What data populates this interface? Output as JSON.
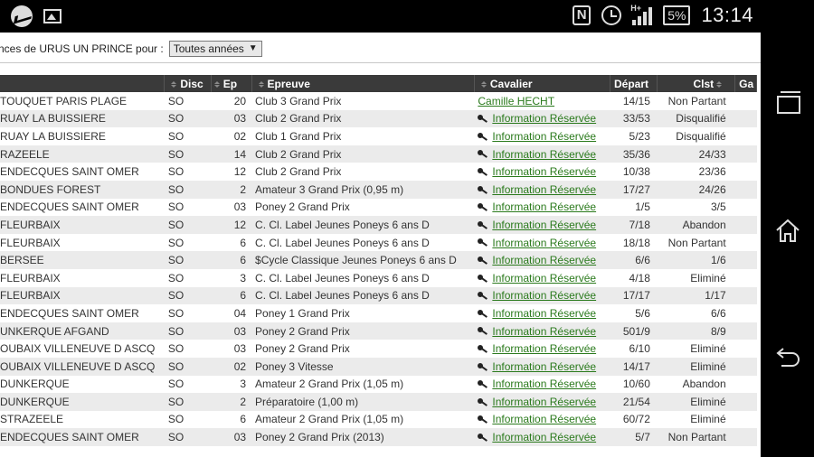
{
  "statusbar": {
    "nfc": "N",
    "network": "H+",
    "battery": "5%",
    "time": "13:14"
  },
  "filter": {
    "label": "nces de URUS UN PRINCE pour :",
    "selected": "Toutes années",
    "caret": "▼"
  },
  "table": {
    "headers": {
      "lieu": "",
      "disc": "Disc",
      "ep": "Ep",
      "epreuve": "Epreuve",
      "cavalier": "Cavalier",
      "depart": "Départ",
      "clst": "Clst",
      "gain": "Ga"
    },
    "rows": [
      {
        "lieu": " TOUQUET PARIS PLAGE",
        "disc": "SO",
        "ep": "20",
        "epreuve": "Club 3 Grand Prix",
        "cavalier": "Camille HECHT",
        "reserved": false,
        "depart": "14/15",
        "clst": "Non Partant"
      },
      {
        "lieu": "RUAY LA BUISSIERE",
        "disc": "SO",
        "ep": "03",
        "epreuve": "Club 2 Grand Prix",
        "cavalier": "Information Réservée",
        "reserved": true,
        "depart": "33/53",
        "clst": "Disqualifié"
      },
      {
        "lieu": "RUAY LA BUISSIERE",
        "disc": "SO",
        "ep": "02",
        "epreuve": "Club 1 Grand Prix",
        "cavalier": "Information Réservée",
        "reserved": true,
        "depart": "5/23",
        "clst": "Disqualifié"
      },
      {
        "lieu": "RAZEELE",
        "disc": "SO",
        "ep": "14",
        "epreuve": "Club 2 Grand Prix",
        "cavalier": "Information Réservée",
        "reserved": true,
        "depart": "35/36",
        "clst": "24/33"
      },
      {
        "lieu": "ENDECQUES SAINT OMER",
        "disc": "SO",
        "ep": "12",
        "epreuve": "Club 2 Grand Prix",
        "cavalier": "Information Réservée",
        "reserved": true,
        "depart": "10/38",
        "clst": "23/36"
      },
      {
        "lieu": "BONDUES FOREST",
        "disc": "SO",
        "ep": "2",
        "epreuve": "Amateur 3 Grand Prix (0,95 m)",
        "cavalier": "Information Réservée",
        "reserved": true,
        "depart": "17/27",
        "clst": "24/26"
      },
      {
        "lieu": "ENDECQUES SAINT OMER",
        "disc": "SO",
        "ep": "03",
        "epreuve": "Poney 2 Grand Prix",
        "cavalier": "Information Réservée",
        "reserved": true,
        "depart": "1/5",
        "clst": "3/5"
      },
      {
        "lieu": "FLEURBAIX",
        "disc": "SO",
        "ep": "12",
        "epreuve": "C. Cl. Label Jeunes Poneys 6 ans D",
        "cavalier": "Information Réservée",
        "reserved": true,
        "depart": "7/18",
        "clst": "Abandon"
      },
      {
        "lieu": "FLEURBAIX",
        "disc": "SO",
        "ep": "6",
        "epreuve": "C. Cl. Label Jeunes Poneys 6 ans D",
        "cavalier": "Information Réservée",
        "reserved": true,
        "depart": "18/18",
        "clst": "Non Partant"
      },
      {
        "lieu": "BERSEE",
        "disc": "SO",
        "ep": "6",
        "epreuve": "$Cycle Classique Jeunes Poneys 6 ans D",
        "cavalier": "Information Réservée",
        "reserved": true,
        "depart": "6/6",
        "clst": "1/6"
      },
      {
        "lieu": "FLEURBAIX",
        "disc": "SO",
        "ep": "3",
        "epreuve": "C. Cl. Label Jeunes Poneys 6 ans D",
        "cavalier": "Information Réservée",
        "reserved": true,
        "depart": "4/18",
        "clst": "Eliminé"
      },
      {
        "lieu": "FLEURBAIX",
        "disc": "SO",
        "ep": "6",
        "epreuve": "C. Cl. Label Jeunes Poneys 6 ans D",
        "cavalier": "Information Réservée",
        "reserved": true,
        "depart": "17/17",
        "clst": "1/17"
      },
      {
        "lieu": "ENDECQUES SAINT OMER",
        "disc": "SO",
        "ep": "04",
        "epreuve": "Poney 1 Grand Prix",
        "cavalier": "Information Réservée",
        "reserved": true,
        "depart": "5/6",
        "clst": "6/6"
      },
      {
        "lieu": "UNKERQUE AFGAND",
        "disc": "SO",
        "ep": "03",
        "epreuve": "Poney 2 Grand Prix",
        "cavalier": "Information Réservée",
        "reserved": true,
        "depart": "501/9",
        "clst": "8/9"
      },
      {
        "lieu": "OUBAIX VILLENEUVE D ASCQ",
        "disc": "SO",
        "ep": "03",
        "epreuve": "Poney 2 Grand Prix",
        "cavalier": "Information Réservée",
        "reserved": true,
        "depart": "6/10",
        "clst": "Eliminé"
      },
      {
        "lieu": "OUBAIX VILLENEUVE D ASCQ",
        "disc": "SO",
        "ep": "02",
        "epreuve": "Poney 3 Vitesse",
        "cavalier": "Information Réservée",
        "reserved": true,
        "depart": "14/17",
        "clst": "Eliminé"
      },
      {
        "lieu": "DUNKERQUE",
        "disc": "SO",
        "ep": "3",
        "epreuve": "Amateur 2 Grand Prix (1,05 m)",
        "cavalier": "Information Réservée",
        "reserved": true,
        "depart": "10/60",
        "clst": "Abandon"
      },
      {
        "lieu": "DUNKERQUE",
        "disc": "SO",
        "ep": "2",
        "epreuve": "Préparatoire (1,00 m)",
        "cavalier": "Information Réservée",
        "reserved": true,
        "depart": "21/54",
        "clst": "Eliminé"
      },
      {
        "lieu": "STRAZEELE",
        "disc": "SO",
        "ep": "6",
        "epreuve": "Amateur 2 Grand Prix (1,05 m)",
        "cavalier": "Information Réservée",
        "reserved": true,
        "depart": "60/72",
        "clst": "Eliminé"
      },
      {
        "lieu": "ENDECQUES SAINT OMER",
        "disc": "SO",
        "ep": "03",
        "epreuve": "Poney 2 Grand Prix (2013)",
        "cavalier": "Information Réservée",
        "reserved": true,
        "depart": "5/7",
        "clst": "Non Partant"
      }
    ]
  },
  "colors": {
    "link": "#2a7a1c",
    "header_bg": "#3a3a3a",
    "row_alt": "#ebebeb"
  }
}
